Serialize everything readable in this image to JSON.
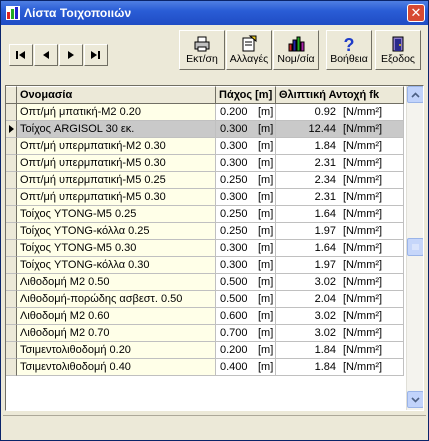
{
  "window": {
    "title": "Λίστα Τοιχοποιιών"
  },
  "toolbar": {
    "print_label": "Εκτ/ση",
    "edit_label": "Αλλαγές",
    "norms_label": "Νομ/σία",
    "help_label": "Βοήθεια",
    "exit_label": "Εξοδος"
  },
  "columns": {
    "name": "Ονομασία",
    "thickness": "Πάχος [m]",
    "strength": "Θλιπτική Αντοχή fk"
  },
  "rows": [
    {
      "name": "Οπτ/μή μπατική-Μ2 0.20",
      "thickness": "0.200",
      "t_unit": "[m]",
      "strength": "0.92",
      "s_unit": "[N/mm²]"
    },
    {
      "name": "Τοίχος ARGISOL 30 εκ.",
      "thickness": "0.300",
      "t_unit": "[m]",
      "strength": "12.44",
      "s_unit": "[N/mm²]"
    },
    {
      "name": "Οπτ/μή υπερμπατική-Μ2 0.30",
      "thickness": "0.300",
      "t_unit": "[m]",
      "strength": "1.84",
      "s_unit": "[N/mm²]"
    },
    {
      "name": "Οπτ/μή υπερμπατική-Μ5 0.30",
      "thickness": "0.300",
      "t_unit": "[m]",
      "strength": "2.31",
      "s_unit": "[N/mm²]"
    },
    {
      "name": "Οπτ/μή υπερμπατική-Μ5 0.25",
      "thickness": "0.250",
      "t_unit": "[m]",
      "strength": "2.34",
      "s_unit": "[N/mm²]"
    },
    {
      "name": "Οπτ/μή υπερμπατική-Μ5 0.30",
      "thickness": "0.300",
      "t_unit": "[m]",
      "strength": "2.31",
      "s_unit": "[N/mm²]"
    },
    {
      "name": "Τοίχος YTONG-M5 0.25",
      "thickness": "0.250",
      "t_unit": "[m]",
      "strength": "1.64",
      "s_unit": "[N/mm²]"
    },
    {
      "name": "Τοίχος YTONG-κόλλα 0.25",
      "thickness": "0.250",
      "t_unit": "[m]",
      "strength": "1.97",
      "s_unit": "[N/mm²]"
    },
    {
      "name": "Τοίχος YTONG-M5 0.30",
      "thickness": "0.300",
      "t_unit": "[m]",
      "strength": "1.64",
      "s_unit": "[N/mm²]"
    },
    {
      "name": "Τοίχος YTONG-κόλλα 0.30",
      "thickness": "0.300",
      "t_unit": "[m]",
      "strength": "1.97",
      "s_unit": "[N/mm²]"
    },
    {
      "name": "Λιθοδομή  Μ2 0.50",
      "thickness": "0.500",
      "t_unit": "[m]",
      "strength": "3.02",
      "s_unit": "[N/mm²]"
    },
    {
      "name": "Λιθοδομή-πορώδης ασβεστ. 0.50",
      "thickness": "0.500",
      "t_unit": "[m]",
      "strength": "2.04",
      "s_unit": "[N/mm²]"
    },
    {
      "name": "Λιθοδομή Μ2 0.60",
      "thickness": "0.600",
      "t_unit": "[m]",
      "strength": "3.02",
      "s_unit": "[N/mm²]"
    },
    {
      "name": "Λιθοδομή Μ2 0.70",
      "thickness": "0.700",
      "t_unit": "[m]",
      "strength": "3.02",
      "s_unit": "[N/mm²]"
    },
    {
      "name": "Τσιμεντολιθοδομή 0.20",
      "thickness": "0.200",
      "t_unit": "[m]",
      "strength": "1.84",
      "s_unit": "[N/mm²]"
    },
    {
      "name": "Τσιμεντολιθοδομή 0.40",
      "thickness": "0.400",
      "t_unit": "[m]",
      "strength": "1.84",
      "s_unit": "[N/mm²]"
    }
  ],
  "selected_row": 1,
  "colors": {
    "title_bar": "#2A5DD6",
    "name_column_bg": "#FFFFE8",
    "selected_row_bg": "#C9C9C9",
    "window_bg": "#ECE9D8"
  }
}
